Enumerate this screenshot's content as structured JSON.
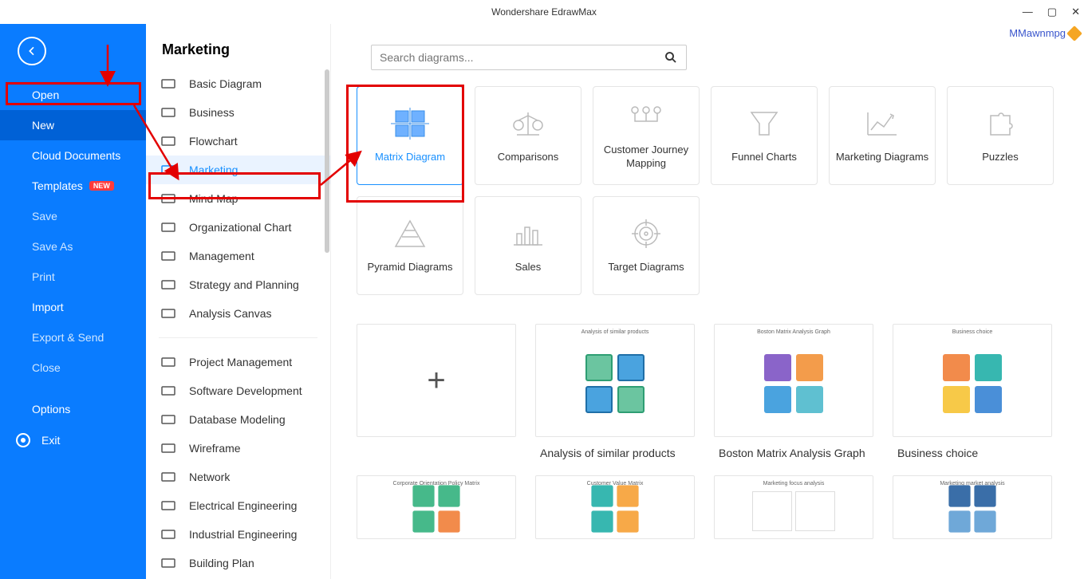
{
  "window": {
    "title": "Wondershare EdrawMax",
    "user": "MMawnmpg"
  },
  "sidebar": {
    "back_aria": "Back",
    "items": [
      {
        "label": "Open",
        "dim": false
      },
      {
        "label": "New",
        "dim": false,
        "selected": true
      },
      {
        "label": "Cloud Documents",
        "dim": false
      },
      {
        "label": "Templates",
        "dim": false,
        "badge": "NEW"
      },
      {
        "label": "Save",
        "dim": true
      },
      {
        "label": "Save As",
        "dim": true
      },
      {
        "label": "Print",
        "dim": true
      },
      {
        "label": "Import",
        "dim": false
      },
      {
        "label": "Export & Send",
        "dim": true
      },
      {
        "label": "Close",
        "dim": true
      },
      {
        "label": "Options",
        "dim": false
      },
      {
        "label": "Exit",
        "dim": false,
        "exit": true
      }
    ]
  },
  "categories": {
    "heading": "Marketing",
    "group1": [
      {
        "label": "Basic Diagram"
      },
      {
        "label": "Business"
      },
      {
        "label": "Flowchart"
      },
      {
        "label": "Marketing",
        "active": true
      },
      {
        "label": "Mind Map"
      },
      {
        "label": "Organizational Chart"
      },
      {
        "label": "Management"
      },
      {
        "label": "Strategy and Planning"
      },
      {
        "label": "Analysis Canvas"
      }
    ],
    "group2": [
      {
        "label": "Project Management"
      },
      {
        "label": "Software Development"
      },
      {
        "label": "Database Modeling"
      },
      {
        "label": "Wireframe"
      },
      {
        "label": "Network"
      },
      {
        "label": "Electrical Engineering"
      },
      {
        "label": "Industrial Engineering"
      },
      {
        "label": "Building Plan"
      }
    ]
  },
  "search": {
    "placeholder": "Search diagrams..."
  },
  "cards": [
    {
      "label": "Matrix Diagram",
      "selected": true,
      "icon": "matrix"
    },
    {
      "label": "Comparisons",
      "icon": "scale"
    },
    {
      "label": "Customer Journey Mapping",
      "icon": "journey"
    },
    {
      "label": "Funnel Charts",
      "icon": "funnel"
    },
    {
      "label": "Marketing Diagrams",
      "icon": "chart"
    },
    {
      "label": "Puzzles",
      "icon": "puzzle"
    },
    {
      "label": "Pyramid Diagrams",
      "icon": "pyramid"
    },
    {
      "label": "Sales",
      "icon": "bars"
    },
    {
      "label": "Target Diagrams",
      "icon": "target"
    }
  ],
  "templates": [
    {
      "label": "",
      "blank": true
    },
    {
      "label": "Analysis of similar products"
    },
    {
      "label": "Boston Matrix Analysis Graph"
    },
    {
      "label": "Business choice"
    }
  ],
  "templates_row2_titles": [
    "Corporate Orientation Policy Matrix",
    "Customer Value Matrix",
    "Marketing focus analysis",
    "Marketing market analysis"
  ]
}
